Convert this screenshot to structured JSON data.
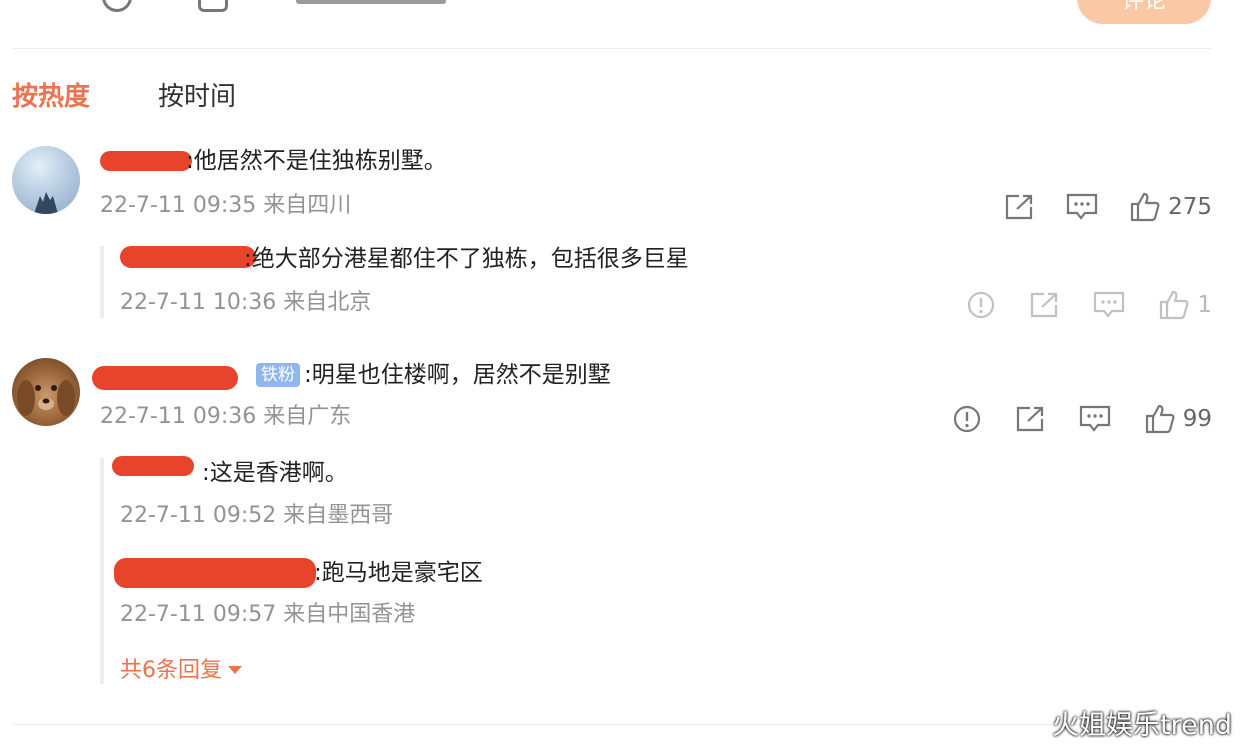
{
  "top_bar": {
    "icons": [
      "emoji-icon",
      "image-icon",
      "topic-icon"
    ],
    "send_label": "评论"
  },
  "sort_tabs": [
    {
      "label": "按热度",
      "active": true
    },
    {
      "label": "按时间",
      "active": false
    }
  ],
  "comments": [
    {
      "text": ":他居然不是住独栋别墅。",
      "meta": "22-7-11 09:35 来自四川",
      "like_count": "275",
      "replies": [
        {
          "text": ":绝大部分港星都住不了独栋，包括很多巨星",
          "meta": "22-7-11 10:36 来自北京",
          "like_count": "1"
        }
      ]
    },
    {
      "badge": "铁粉",
      "text": ":明星也住楼啊，居然不是别墅",
      "meta": "22-7-11 09:36 来自广东",
      "like_count": "99",
      "replies": [
        {
          "text": ":这是香港啊。",
          "meta": "22-7-11 09:52 来自墨西哥"
        },
        {
          "text": ":跑马地是豪宅区",
          "meta": "22-7-11 09:57 来自中国香港"
        }
      ],
      "more_replies": "共6条回复"
    }
  ],
  "watermark": "火姐娱乐trend",
  "colors": {
    "accent": "#eb7350",
    "meta_gray": "#939393",
    "redaction": "#e8442b",
    "badge": "#8fb6ef"
  }
}
